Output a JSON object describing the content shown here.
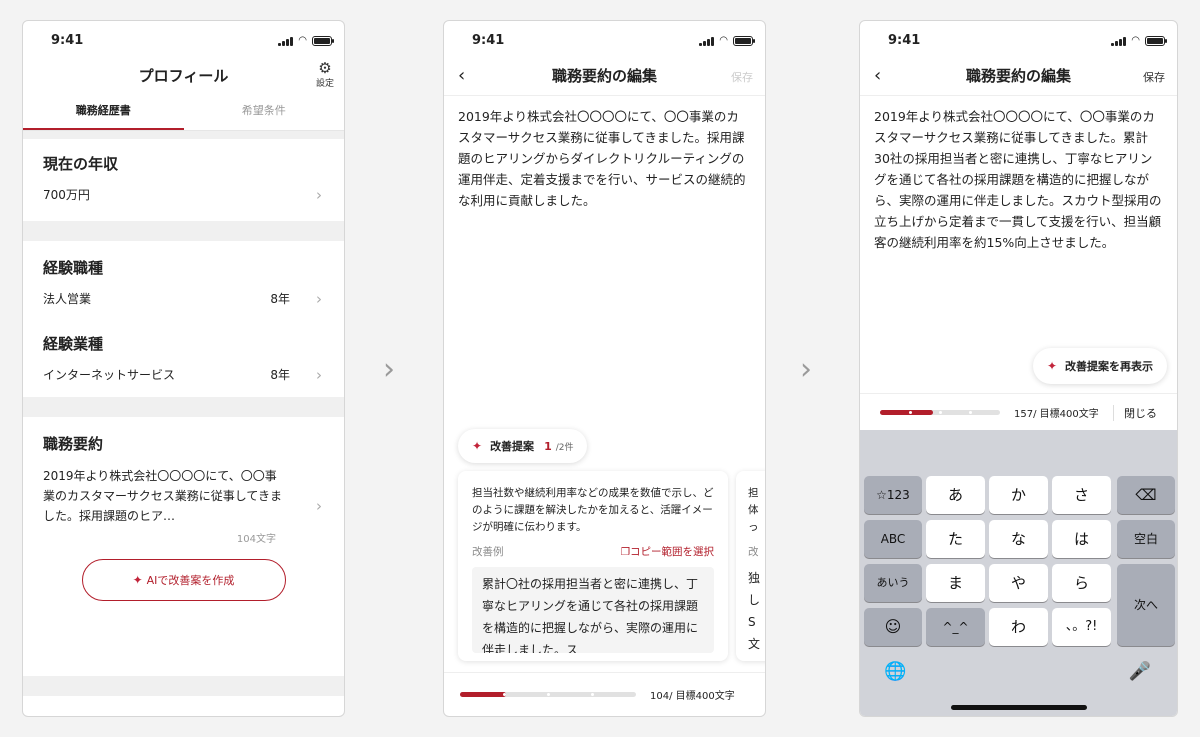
{
  "status": {
    "time": "9:41"
  },
  "screen1": {
    "nav_title": "プロフィール",
    "settings_label": "設定",
    "tabs": [
      {
        "label": "職務経歴書"
      },
      {
        "label": "希望条件"
      }
    ],
    "income": {
      "title": "現在の年収",
      "value": "700万円"
    },
    "job_type": {
      "title": "経験職種",
      "name": "法人営業",
      "years": "8年"
    },
    "industry": {
      "title": "経験業種",
      "name": "インターネットサービス",
      "years": "8年"
    },
    "summary": {
      "title": "職務要約",
      "text": "2019年より株式会社〇〇〇〇にて、〇〇事業のカスタマーサクセス業務に従事してきました。採用課題のヒア…",
      "chars": "104文字"
    },
    "ai_button": "AIで改善案を作成"
  },
  "screen2": {
    "nav_title": "職務要約の編集",
    "save_label": "保存",
    "body": "2019年より株式会社〇〇〇〇にて、〇〇事業のカスタマーサクセス業務に従事してきました。採用課題のヒアリングからダイレクトリクルーティングの運用伴走、定着支援までを行い、サービスの継続的な利用に貢献しました。",
    "suggest_pill": {
      "label": "改善提案",
      "index": "1",
      "total": "/2件"
    },
    "card1": {
      "advice": "担当社数や継続利用率などの成果を数値で示し、どのように課題を解決したかを加えると、活躍イメージが明確に伝わります。",
      "example_label": "改善例",
      "copy_label": "コピー範囲を選択",
      "example": "累計〇社の採用担当者と密に連携し、丁寧なヒアリングを通じて各社の採用課題を構造的に把握しながら、実際の運用に伴走しました。ス"
    },
    "card2": {
      "line1": "担",
      "line2": "体",
      "line3": "っ",
      "label": "改",
      "e1": "独",
      "e2": "し",
      "e3": "S",
      "e4": "文"
    },
    "progress": {
      "fraction": 0.26,
      "label": "104/ 目標400文字"
    }
  },
  "screen3": {
    "nav_title": "職務要約の編集",
    "save_label": "保存",
    "body": "2019年より株式会社〇〇〇〇にて、〇〇事業のカスタマーサクセス業務に従事してきました。累計30社の採用担当者と密に連携し、丁寧なヒアリングを通じて各社の採用課題を構造的に把握しながら、実際の運用に伴走しました。スカウト型採用の立ち上げから定着まで一貫して支援を行い、担当顧客の継続利用率を約15%向上させました。",
    "reshow_pill": "改善提案を再表示",
    "progress": {
      "fraction": 0.44,
      "label": "157/ 目標400文字"
    },
    "close_label": "閉じる",
    "keyboard": {
      "row1": [
        "☆123",
        "あ",
        "か",
        "さ",
        "⌫"
      ],
      "row2": [
        "ABC",
        "た",
        "な",
        "は",
        "空白"
      ],
      "row3": [
        "あいう",
        "ま",
        "や",
        "ら",
        "次へ"
      ],
      "row4": [
        "☺",
        "^_^",
        "わ",
        "、。?!"
      ],
      "globe": "🌐",
      "mic": "🎤"
    }
  }
}
